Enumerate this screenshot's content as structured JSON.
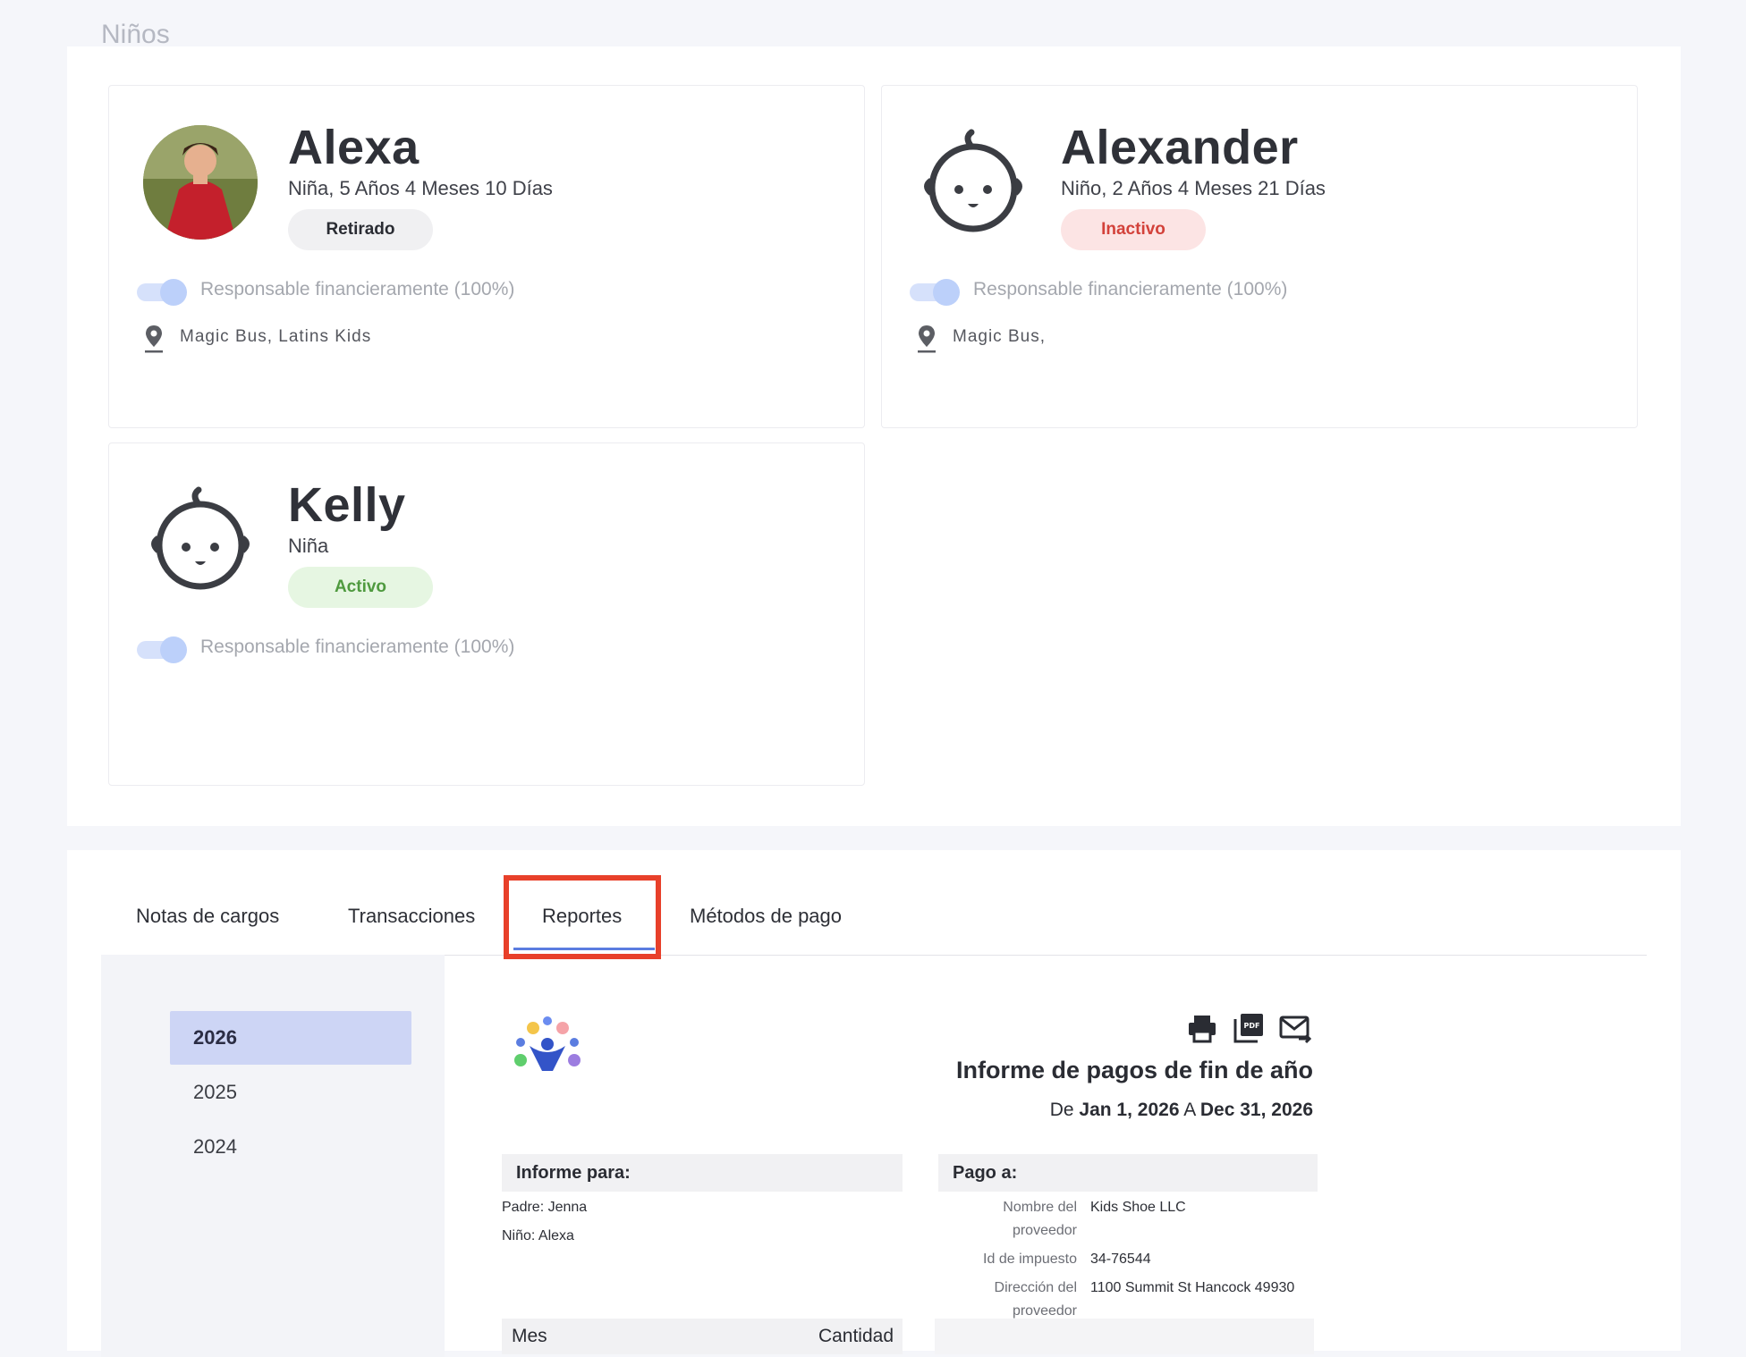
{
  "section": {
    "title": "Niños"
  },
  "children": [
    {
      "name": "Alexa",
      "subtitle": "Niña, 5 Años 4 Meses 10 Días",
      "status": "Retirado",
      "responsible": "Responsable financieramente (100%)",
      "location": "Magic Bus, Latins Kids",
      "avatar": "child-photo"
    },
    {
      "name": "Alexander",
      "subtitle": "Niño, 2 Años 4 Meses 21 Días",
      "status": "Inactivo",
      "responsible": "Responsable financieramente (100%)",
      "location": "Magic Bus,",
      "avatar": "baby-face-icon"
    },
    {
      "name": "Kelly",
      "subtitle": "Niña",
      "status": "Activo",
      "responsible": "Responsable financieramente (100%)",
      "avatar": "baby-face-icon"
    }
  ],
  "tabs": [
    {
      "label": "Notas de cargos"
    },
    {
      "label": "Transacciones"
    },
    {
      "label": "Reportes",
      "active": true
    },
    {
      "label": "Métodos de pago"
    }
  ],
  "years": [
    "2026",
    "2025",
    "2024"
  ],
  "selected_year": "2026",
  "report": {
    "title": "Informe de pagos de fin de año",
    "range_prefix": "De",
    "range_start": "Jan 1, 2026",
    "range_mid": "A",
    "range_end": "Dec 31, 2026",
    "actions": [
      "print-icon",
      "pdf-icon",
      "email-icon"
    ],
    "for": {
      "heading": "Informe para:",
      "parent": "Padre: Jenna",
      "child": "Niño: Alexa"
    },
    "pay_to": {
      "heading": "Pago a:",
      "provider_name_label_1": "Nombre del",
      "provider_name_label_2": "proveedor",
      "provider_name": "Kids Shoe LLC",
      "tax_id_label": "Id de impuesto",
      "tax_id": "34-76544",
      "address_label_1": "Dirección del",
      "address_label_2": "proveedor",
      "address": "1100 Summit St Hancock 49930"
    },
    "table": {
      "col_month": "Mes",
      "col_amount": "Cantidad"
    }
  },
  "colors": {
    "accent": "#5b7de0",
    "highlight": "#e8402a",
    "status_retired_bg": "#f0f0f2",
    "status_inactive_bg": "#fce4e4",
    "status_active_bg": "#e6f6e2"
  }
}
